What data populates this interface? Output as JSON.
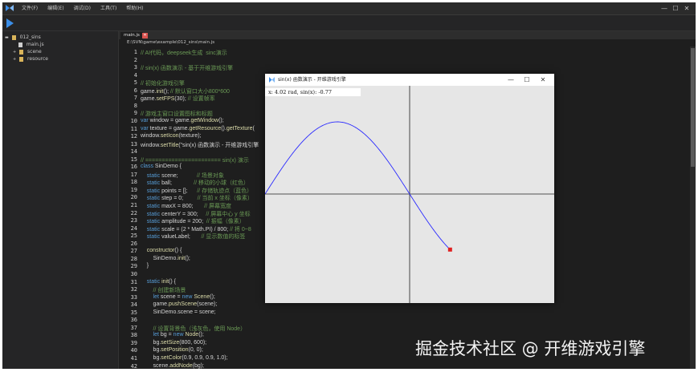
{
  "menu": [
    "文件(F)",
    "编辑(E)",
    "调试(D)",
    "工具(T)",
    "帮助(H)"
  ],
  "window_controls": [
    "—",
    "☐",
    "✕"
  ],
  "sidebar": {
    "project": "012_sins",
    "children": [
      "main.js",
      "scene",
      "resource"
    ]
  },
  "editor": {
    "tab_label": "main.js",
    "tab_close": "✕",
    "path": "E:\\SVN\\game\\example\\012_sins\\main.js"
  },
  "code_lines": [
    [
      {
        "t": "// AI代码，deepseek生成  sinc演示",
        "c": "comment"
      }
    ],
    [],
    [
      {
        "t": "// sin(x) 函数演示 - 基于开维游戏引擎",
        "c": "comment"
      }
    ],
    [],
    [
      {
        "t": "// 初始化游戏引擎",
        "c": "comment"
      }
    ],
    [
      {
        "t": "game.",
        "c": "plain"
      },
      {
        "t": "init",
        "c": "func"
      },
      {
        "t": "(); ",
        "c": "plain"
      },
      {
        "t": "// 默认窗口大小800*600",
        "c": "comment"
      }
    ],
    [
      {
        "t": "game.",
        "c": "plain"
      },
      {
        "t": "setFPS",
        "c": "func"
      },
      {
        "t": "(30); ",
        "c": "plain"
      },
      {
        "t": "// 设置帧率",
        "c": "comment"
      }
    ],
    [],
    [
      {
        "t": "// 游戏主窗口设置图标和标题",
        "c": "comment"
      }
    ],
    [
      {
        "t": "var ",
        "c": "kw"
      },
      {
        "t": "window = game.",
        "c": "plain"
      },
      {
        "t": "getWindow",
        "c": "func"
      },
      {
        "t": "();",
        "c": "plain"
      }
    ],
    [
      {
        "t": "var ",
        "c": "kw"
      },
      {
        "t": "texture = game.",
        "c": "plain"
      },
      {
        "t": "getResource",
        "c": "func"
      },
      {
        "t": "().",
        "c": "plain"
      },
      {
        "t": "getTexture",
        "c": "func"
      },
      {
        "t": "(",
        "c": "plain"
      }
    ],
    [
      {
        "t": "window.",
        "c": "plain"
      },
      {
        "t": "setIcon",
        "c": "func"
      },
      {
        "t": "(texture);",
        "c": "plain"
      }
    ],
    [
      {
        "t": "window.",
        "c": "plain"
      },
      {
        "t": "setTitle",
        "c": "func"
      },
      {
        "t": "(\"sin(x) 函数演示 - 开维游戏引擎",
        "c": "plain"
      }
    ],
    [],
    [
      {
        "t": "// ======================= sin(x) 演示",
        "c": "comment"
      }
    ],
    [
      {
        "t": "class ",
        "c": "kw"
      },
      {
        "t": "SinDemo {",
        "c": "plain"
      }
    ],
    [
      {
        "t": "    static ",
        "c": "kw"
      },
      {
        "t": "scene;            ",
        "c": "plain"
      },
      {
        "t": "// 场景对象",
        "c": "comment"
      }
    ],
    [
      {
        "t": "    static ",
        "c": "kw"
      },
      {
        "t": "ball;              ",
        "c": "plain"
      },
      {
        "t": "// 移动的小球（红色）",
        "c": "comment"
      }
    ],
    [
      {
        "t": "    static ",
        "c": "kw"
      },
      {
        "t": "points = [];      ",
        "c": "plain"
      },
      {
        "t": "// 存储轨迹点（蓝色）",
        "c": "comment"
      }
    ],
    [
      {
        "t": "    static ",
        "c": "kw"
      },
      {
        "t": "step = 0;         ",
        "c": "plain"
      },
      {
        "t": "// 当前 x 坐标（像素）",
        "c": "comment"
      }
    ],
    [
      {
        "t": "    static ",
        "c": "kw"
      },
      {
        "t": "maxX = 800;       ",
        "c": "plain"
      },
      {
        "t": "// 屏幕宽度",
        "c": "comment"
      }
    ],
    [
      {
        "t": "    static ",
        "c": "kw"
      },
      {
        "t": "centerY = 300;     ",
        "c": "plain"
      },
      {
        "t": "// 屏幕中心 y 坐标",
        "c": "comment"
      }
    ],
    [
      {
        "t": "    static ",
        "c": "kw"
      },
      {
        "t": "amplitude = 200;  ",
        "c": "plain"
      },
      {
        "t": "// 振幅（像素）",
        "c": "comment"
      }
    ],
    [
      {
        "t": "    static ",
        "c": "kw"
      },
      {
        "t": "scale = (2 * Math.PI) / 800; ",
        "c": "plain"
      },
      {
        "t": "// 将 0~8",
        "c": "comment"
      }
    ],
    [
      {
        "t": "    static ",
        "c": "kw"
      },
      {
        "t": "valueLabel;       ",
        "c": "plain"
      },
      {
        "t": "// 显示数值的标签",
        "c": "comment"
      }
    ],
    [],
    [
      {
        "t": "    ",
        "c": "plain"
      },
      {
        "t": "constructor",
        "c": "func"
      },
      {
        "t": "() {",
        "c": "plain"
      }
    ],
    [
      {
        "t": "        SinDemo.",
        "c": "plain"
      },
      {
        "t": "init",
        "c": "func"
      },
      {
        "t": "();",
        "c": "plain"
      }
    ],
    [
      {
        "t": "    }",
        "c": "plain"
      }
    ],
    [],
    [
      {
        "t": "    static ",
        "c": "kw"
      },
      {
        "t": "init",
        "c": "func"
      },
      {
        "t": "() {",
        "c": "plain"
      }
    ],
    [
      {
        "t": "        // 创建新场景",
        "c": "comment"
      }
    ],
    [
      {
        "t": "        let ",
        "c": "kw"
      },
      {
        "t": "scene = ",
        "c": "plain"
      },
      {
        "t": "new ",
        "c": "kw"
      },
      {
        "t": "Scene",
        "c": "func"
      },
      {
        "t": "();",
        "c": "plain"
      }
    ],
    [
      {
        "t": "        game.",
        "c": "plain"
      },
      {
        "t": "pushScene",
        "c": "func"
      },
      {
        "t": "(scene);",
        "c": "plain"
      }
    ],
    [
      {
        "t": "        SinDemo.scene = scene;",
        "c": "plain"
      }
    ],
    [],
    [
      {
        "t": "        // 设置背景色（浅灰色，使用 Node）",
        "c": "comment"
      }
    ],
    [
      {
        "t": "        let ",
        "c": "kw"
      },
      {
        "t": "bg = ",
        "c": "plain"
      },
      {
        "t": "new ",
        "c": "kw"
      },
      {
        "t": "Node",
        "c": "func"
      },
      {
        "t": "();",
        "c": "plain"
      }
    ],
    [
      {
        "t": "        bg.",
        "c": "plain"
      },
      {
        "t": "setSize",
        "c": "func"
      },
      {
        "t": "(800, 600);",
        "c": "plain"
      }
    ],
    [
      {
        "t": "        bg.",
        "c": "plain"
      },
      {
        "t": "setPosition",
        "c": "func"
      },
      {
        "t": "(0, 0);",
        "c": "plain"
      }
    ],
    [
      {
        "t": "        bg.",
        "c": "plain"
      },
      {
        "t": "setColor",
        "c": "func"
      },
      {
        "t": "(0.9, 0.9, 0.9, 1.0);",
        "c": "plain"
      }
    ],
    [
      {
        "t": "        scene.",
        "c": "plain"
      },
      {
        "t": "addNode",
        "c": "func"
      },
      {
        "t": "(bg);",
        "c": "plain"
      }
    ]
  ],
  "popup": {
    "title": "sin(x) 函数演示 - 开维游戏引擎",
    "controls": [
      "—",
      "☐",
      "✕"
    ],
    "value_label": "x: 4.02 rad, sin(x): -0.77"
  },
  "colors": {
    "curve": "#2a2aff",
    "ball": "#e02020",
    "axis": "#202020"
  },
  "chart_data": {
    "type": "line",
    "function": "sin",
    "x_min": 0,
    "x_max": 4.02,
    "period": 6.2832,
    "current": {
      "x": 4.02,
      "y": -0.77
    }
  },
  "watermark": "掘金技术社区 @ 开维游戏引擎"
}
